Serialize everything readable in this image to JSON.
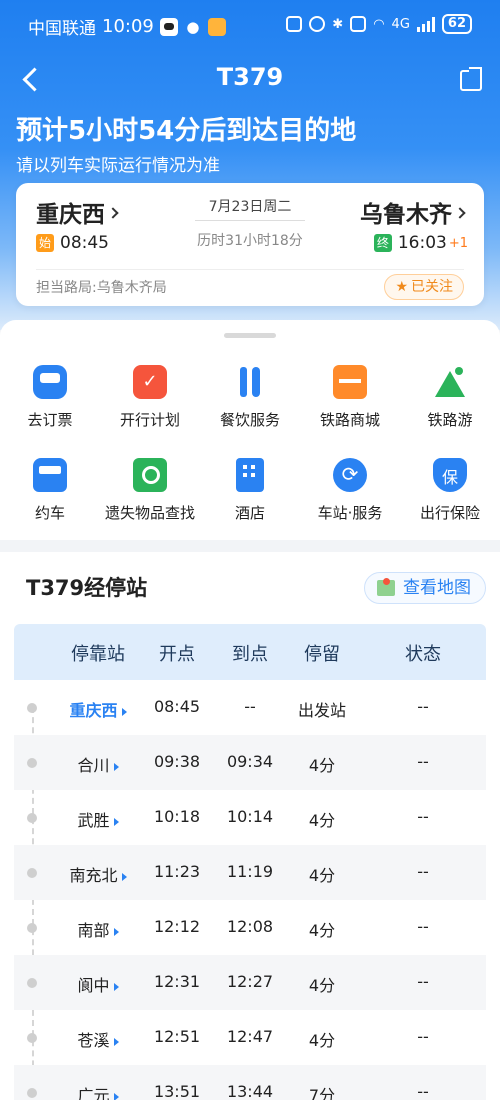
{
  "status_bar": {
    "carrier": "中国联通",
    "time": "10:09",
    "network": "4G",
    "battery": "62"
  },
  "nav": {
    "title": "T379"
  },
  "eta": {
    "headline": "预计5小时54分后到达目的地",
    "note": "请以列车实际运行情况为准"
  },
  "train": {
    "from_station": "重庆西",
    "to_station": "乌鲁木齐",
    "date": "7月23日周二",
    "duration": "历时31小时18分",
    "from_tag": "始",
    "to_tag": "终",
    "depart_time": "08:45",
    "arrive_time": "16:03",
    "arrive_day_offset": "+1",
    "bureau": "担当路局:乌鲁木齐局",
    "follow_label": "已关注"
  },
  "services": [
    {
      "label": "去订票",
      "icon": "train-icon"
    },
    {
      "label": "开行计划",
      "icon": "calendar-icon"
    },
    {
      "label": "餐饮服务",
      "icon": "dining-icon"
    },
    {
      "label": "铁路商城",
      "icon": "shop-icon"
    },
    {
      "label": "铁路游",
      "icon": "mountain-icon"
    },
    {
      "label": "约车",
      "icon": "taxi-icon"
    },
    {
      "label": "遗失物品查找",
      "icon": "lost-found-icon"
    },
    {
      "label": "酒店",
      "icon": "hotel-icon"
    },
    {
      "label": "车站·服务",
      "icon": "station-service-icon"
    },
    {
      "label": "出行保险",
      "icon": "insurance-icon"
    }
  ],
  "stops": {
    "title": "T379经停站",
    "map_button": "查看地图",
    "columns": [
      "停靠站",
      "开点",
      "到点",
      "停留",
      "状态"
    ],
    "rows": [
      {
        "station": "重庆西",
        "depart": "08:45",
        "arrive": "--",
        "stay": "出发站",
        "status": "--"
      },
      {
        "station": "合川",
        "depart": "09:38",
        "arrive": "09:34",
        "stay": "4分",
        "status": "--"
      },
      {
        "station": "武胜",
        "depart": "10:18",
        "arrive": "10:14",
        "stay": "4分",
        "status": "--"
      },
      {
        "station": "南充北",
        "depart": "11:23",
        "arrive": "11:19",
        "stay": "4分",
        "status": "--"
      },
      {
        "station": "南部",
        "depart": "12:12",
        "arrive": "12:08",
        "stay": "4分",
        "status": "--"
      },
      {
        "station": "阆中",
        "depart": "12:31",
        "arrive": "12:27",
        "stay": "4分",
        "status": "--"
      },
      {
        "station": "苍溪",
        "depart": "12:51",
        "arrive": "12:47",
        "stay": "4分",
        "status": "--"
      },
      {
        "station": "广元",
        "depart": "13:51",
        "arrive": "13:44",
        "stay": "7分",
        "status": "--"
      }
    ]
  }
}
